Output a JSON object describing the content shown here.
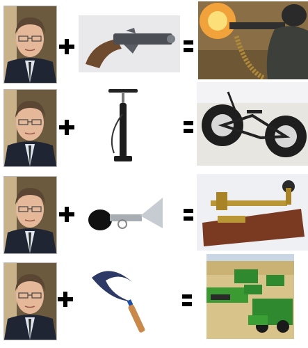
{
  "rows": [
    {
      "item": "flintlock-pistol",
      "result": "machine-gun-firing"
    },
    {
      "item": "bicycle-pump",
      "result": "fat-tire-bike"
    },
    {
      "item": "bulb-horn",
      "result": "telegraph-key"
    },
    {
      "item": "sickle",
      "result": "combine-harvester"
    }
  ],
  "operators": {
    "plus": "+",
    "equals": "="
  }
}
